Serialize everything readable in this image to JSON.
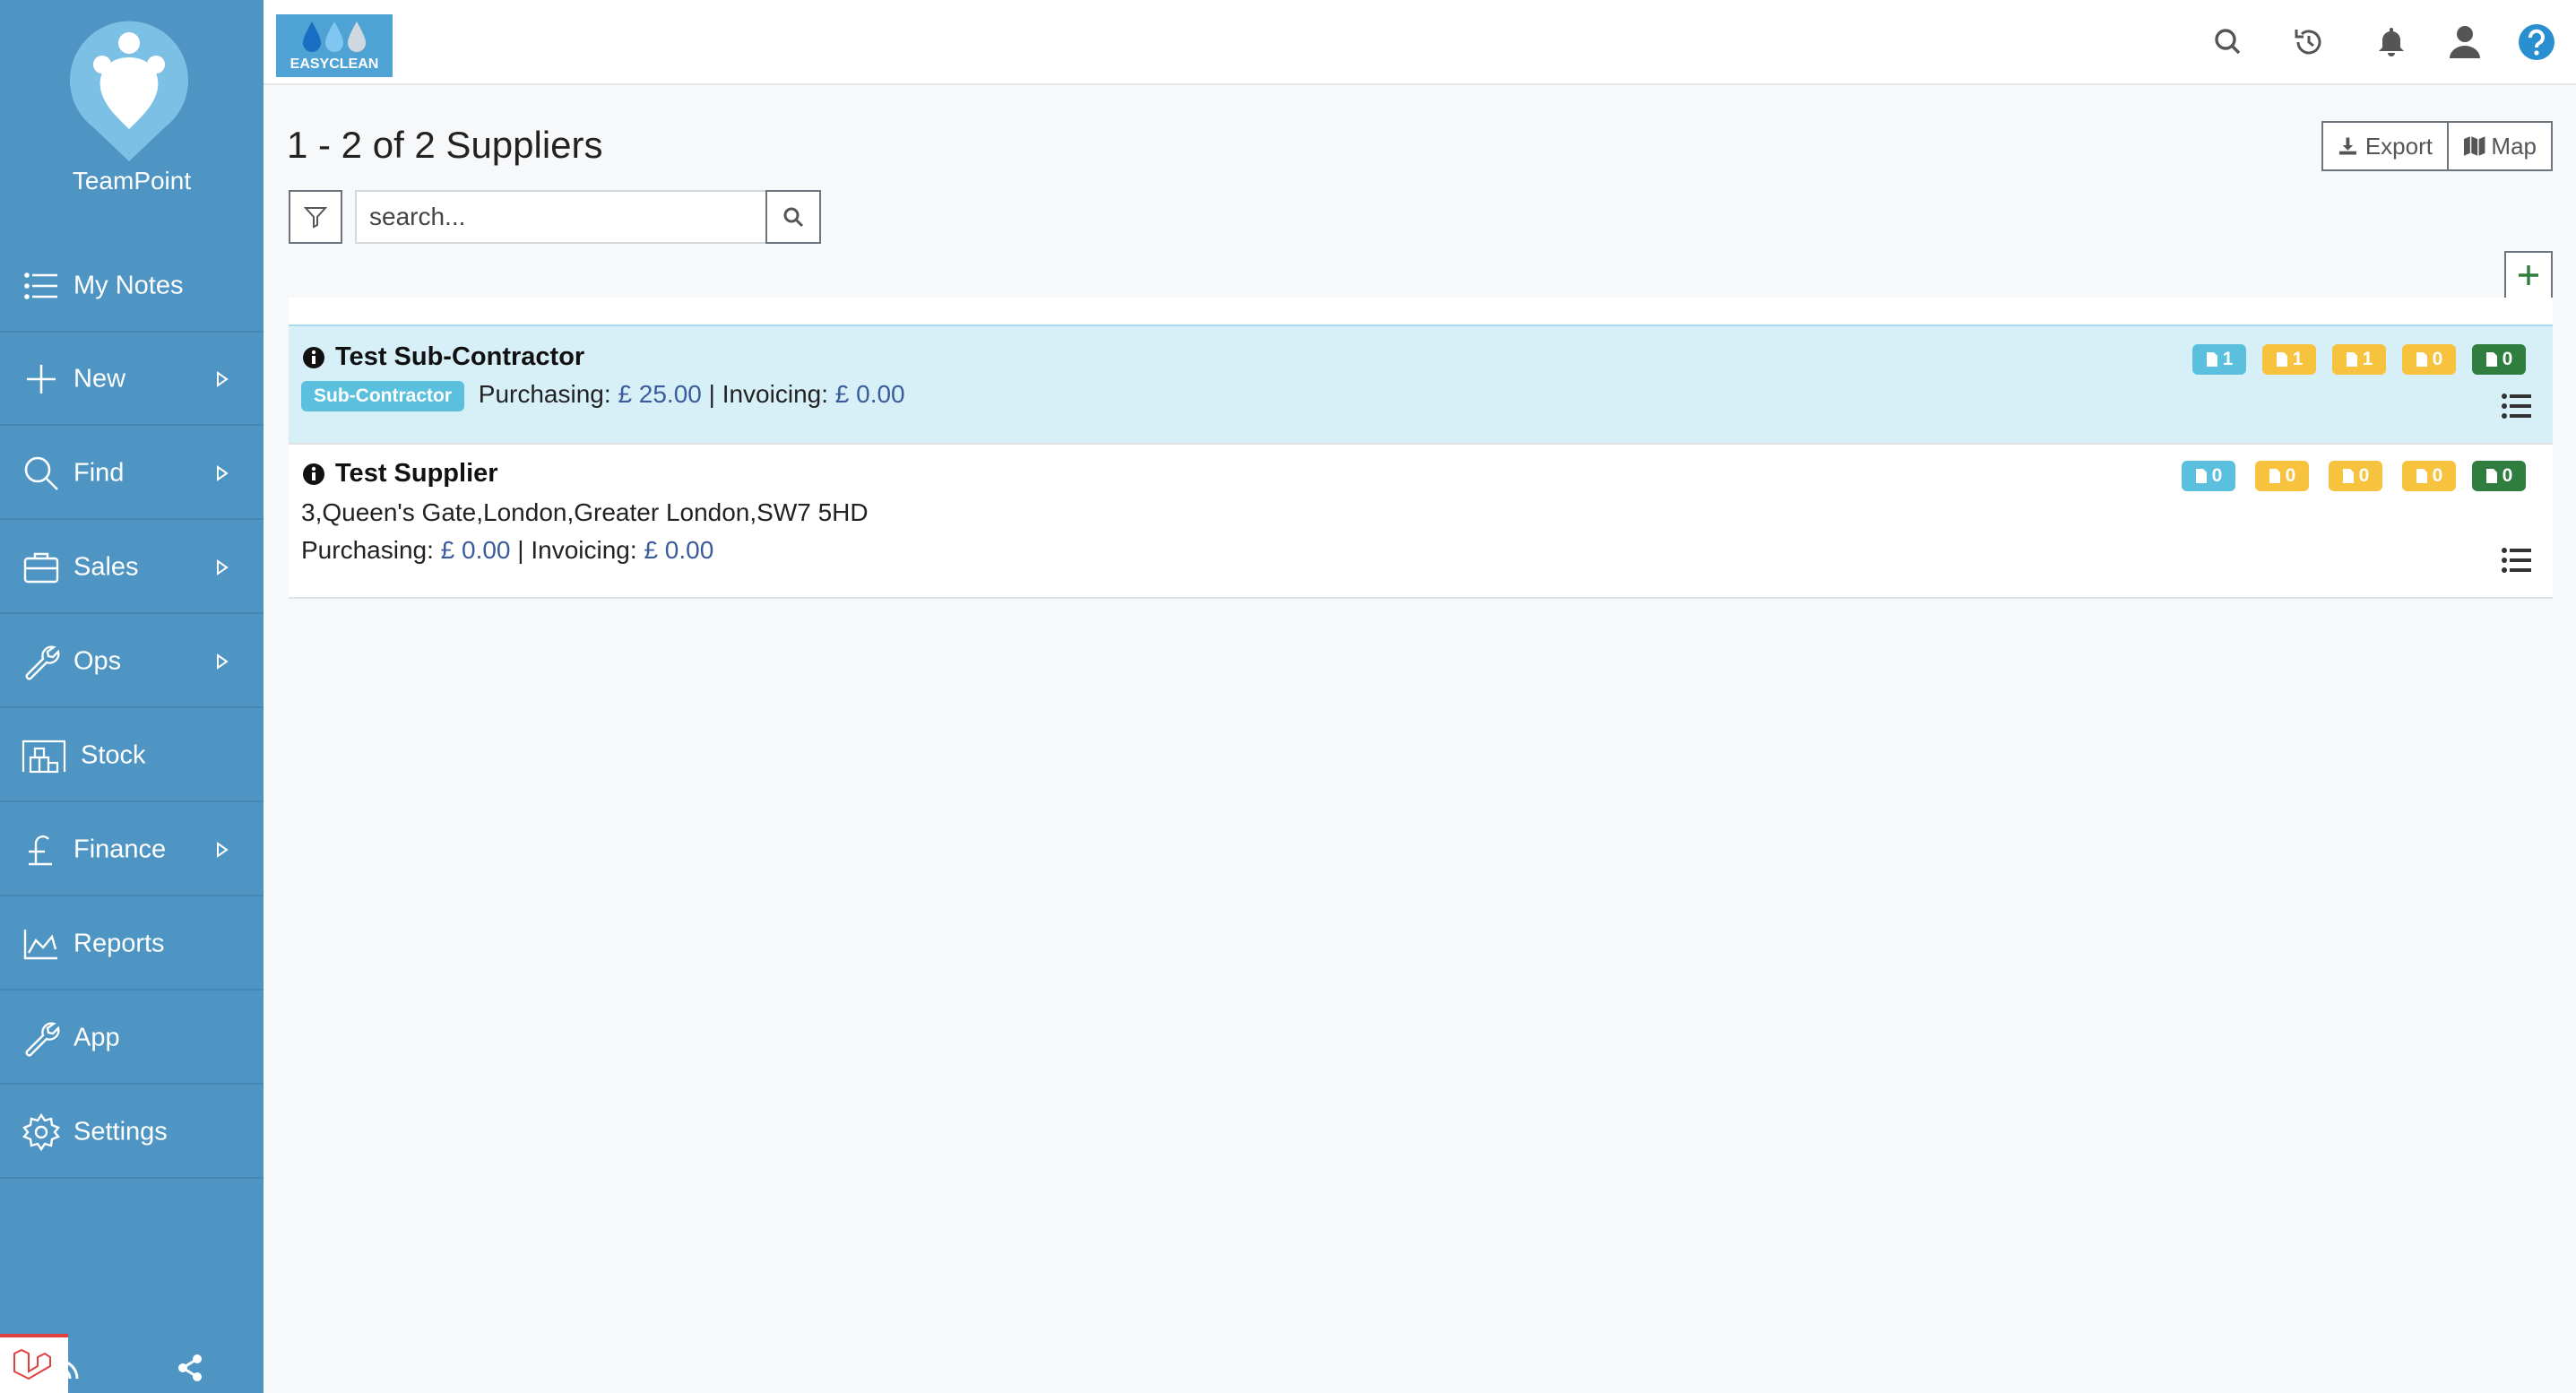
{
  "app": {
    "name": "TeamPoint",
    "company_logo_text": "EASYCLEAN"
  },
  "sidebar": {
    "items": [
      {
        "label": "My Notes",
        "icon": "list-icon",
        "has_submenu": false
      },
      {
        "label": "New",
        "icon": "plus-icon",
        "has_submenu": true
      },
      {
        "label": "Find",
        "icon": "search-icon",
        "has_submenu": true
      },
      {
        "label": "Sales",
        "icon": "briefcase-icon",
        "has_submenu": true
      },
      {
        "label": "Ops",
        "icon": "wrench-icon",
        "has_submenu": true
      },
      {
        "label": "Stock",
        "icon": "warehouse-icon",
        "has_submenu": false
      },
      {
        "label": "Finance",
        "icon": "pound-icon",
        "has_submenu": true
      },
      {
        "label": "Reports",
        "icon": "chart-area-icon",
        "has_submenu": false
      },
      {
        "label": "App",
        "icon": "wrench-icon",
        "has_submenu": false
      },
      {
        "label": "Settings",
        "icon": "gear-icon",
        "has_submenu": false
      }
    ]
  },
  "topbar": {
    "icons": [
      "search-icon",
      "history-icon",
      "bell-icon",
      "user-icon",
      "help-icon"
    ]
  },
  "page": {
    "title": "1 - 2 of 2 Suppliers",
    "export_label": "Export",
    "map_label": "Map",
    "search_placeholder": "search..."
  },
  "suppliers": [
    {
      "name": "Test Sub-Contractor",
      "tag": "Sub-Contractor",
      "purchasing_label": "Purchasing:",
      "purchasing_value": "£ 25.00",
      "separator": "|",
      "invoicing_label": "Invoicing:",
      "invoicing_value": "£ 0.00",
      "badges": [
        "1",
        "1",
        "1",
        "0",
        "0"
      ]
    },
    {
      "name": "Test Supplier",
      "address": "3,Queen's Gate,London,Greater London,SW7 5HD",
      "purchasing_label": "Purchasing:",
      "purchasing_value": "£ 0.00",
      "separator": "|",
      "invoicing_label": "Invoicing:",
      "invoicing_value": "£ 0.00",
      "badges": [
        "0",
        "0",
        "0",
        "0",
        "0"
      ]
    }
  ],
  "colors": {
    "sidebar": "#4f95c3",
    "badge_blue": "#5bc0de",
    "badge_yellow": "#f7c23e",
    "badge_green": "#2f7d3f",
    "row_highlight": "#d7f0f8"
  }
}
